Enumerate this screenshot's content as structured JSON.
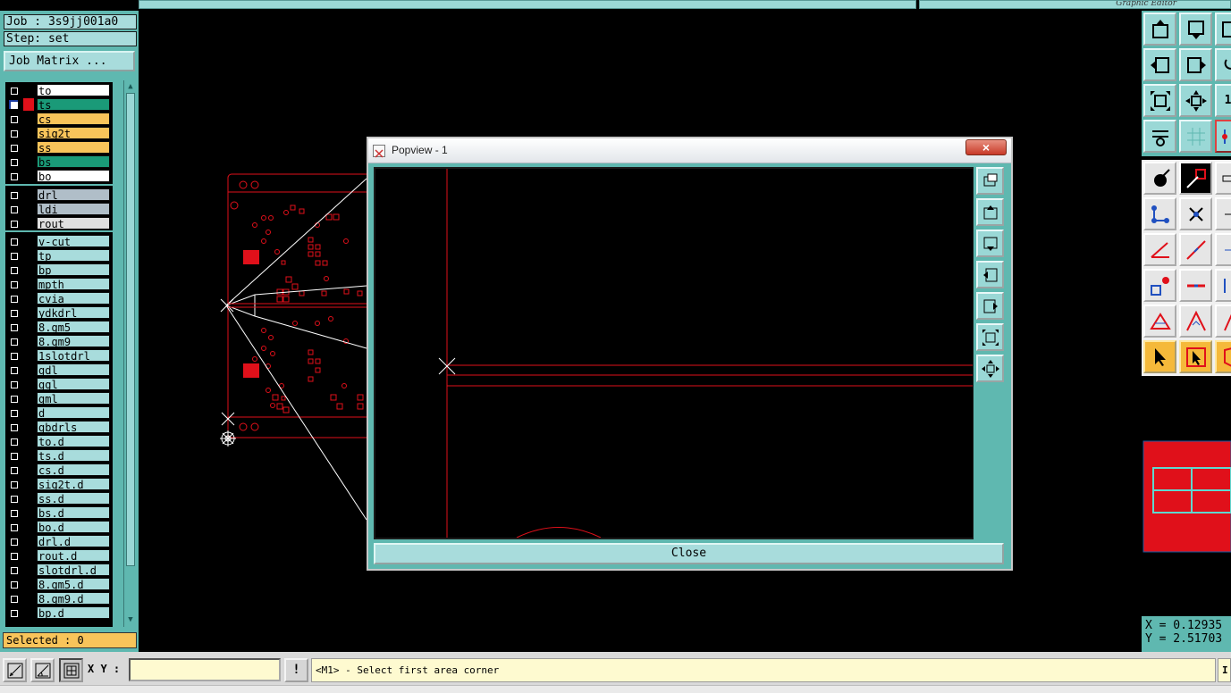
{
  "window": {
    "title": "Graphic Editor"
  },
  "job": {
    "job_text": "Job : 3s9jj001a0",
    "step_text": "Step: set",
    "job_matrix_label": "Job Matrix ..."
  },
  "layers": {
    "group1": [
      {
        "name": "to",
        "color": "#ffffff",
        "checked": false
      },
      {
        "name": "ts",
        "color": "#1a9a78",
        "checked": true,
        "work": true
      },
      {
        "name": "cs",
        "color": "#f8c45a",
        "checked": false
      },
      {
        "name": "sig2t",
        "color": "#f8c45a",
        "checked": false
      },
      {
        "name": "ss",
        "color": "#f8c45a",
        "checked": false
      },
      {
        "name": "bs",
        "color": "#1a9a78",
        "checked": false
      },
      {
        "name": "bo",
        "color": "#ffffff",
        "checked": false
      }
    ],
    "group2": [
      {
        "name": "drl",
        "color": "#b0bec8",
        "checked": false
      },
      {
        "name": "ldi",
        "color": "#b0bec8",
        "checked": false
      },
      {
        "name": "rout",
        "color": "#e0e0e0",
        "checked": false
      }
    ],
    "group3": [
      {
        "name": "v-cut"
      },
      {
        "name": "tp"
      },
      {
        "name": "bp"
      },
      {
        "name": "mpth"
      },
      {
        "name": "cvia"
      },
      {
        "name": "ydkdrl"
      },
      {
        "name": "8.gm5"
      },
      {
        "name": "8.gm9"
      },
      {
        "name": "1slotdrl"
      },
      {
        "name": "gdl"
      },
      {
        "name": "ggl"
      },
      {
        "name": "gml"
      },
      {
        "name": "d"
      },
      {
        "name": "gbdrls"
      },
      {
        "name": "to.d"
      },
      {
        "name": "ts.d"
      },
      {
        "name": "cs.d"
      },
      {
        "name": "sig2t.d"
      },
      {
        "name": "ss.d"
      },
      {
        "name": "bs.d"
      },
      {
        "name": "bo.d"
      },
      {
        "name": "drl.d"
      },
      {
        "name": "rout.d"
      },
      {
        "name": "slotdrl.d"
      },
      {
        "name": "8.gm5.d"
      },
      {
        "name": "8.gm9.d"
      },
      {
        "name": "bp.d"
      }
    ],
    "misc_layer_color": "#a8dcdc"
  },
  "selected_text": "Selected : 0",
  "bottom": {
    "xy_label": "X Y :",
    "xy_value": "",
    "warn_label": "!",
    "status_message": "<M1> - Select first area corner",
    "right_label": "I"
  },
  "popview": {
    "title": "Popview - 1",
    "close_x": "×",
    "close_label": "Close"
  },
  "coords": {
    "x_text": "X = 0.12935",
    "y_text": "Y = 2.51703"
  },
  "colors": {
    "accent": "#5fb8b0",
    "panel_light": "#a8dcdc",
    "feature_red": "#e0101a",
    "warn_orange": "#f8c45a"
  }
}
